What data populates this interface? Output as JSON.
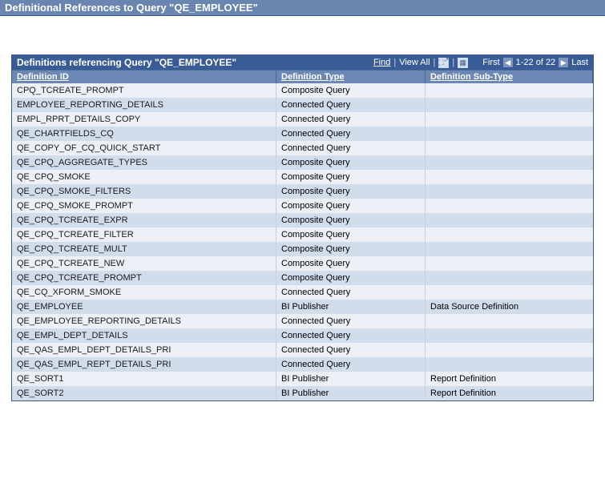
{
  "page_title": "Definitional References to Query \"QE_EMPLOYEE\"",
  "grid": {
    "title": "Definitions referencing Query \"QE_EMPLOYEE\"",
    "actions": {
      "find": "Find",
      "view_all": "View All"
    },
    "pager": {
      "first_label": "First",
      "range_label": "1-22 of 22",
      "last_label": "Last"
    },
    "columns": {
      "id": "Definition ID",
      "type": "Definition Type",
      "subtype": "Definition Sub-Type"
    },
    "rows": [
      {
        "id": "CPQ_TCREATE_PROMPT",
        "type": "Composite Query",
        "subtype": ""
      },
      {
        "id": "EMPLOYEE_REPORTING_DETAILS",
        "type": "Connected Query",
        "subtype": ""
      },
      {
        "id": "EMPL_RPRT_DETAILS_COPY",
        "type": "Connected Query",
        "subtype": ""
      },
      {
        "id": "QE_CHARTFIELDS_CQ",
        "type": "Connected Query",
        "subtype": ""
      },
      {
        "id": "QE_COPY_OF_CQ_QUICK_START",
        "type": "Connected Query",
        "subtype": ""
      },
      {
        "id": "QE_CPQ_AGGREGATE_TYPES",
        "type": "Composite Query",
        "subtype": ""
      },
      {
        "id": "QE_CPQ_SMOKE",
        "type": "Composite Query",
        "subtype": ""
      },
      {
        "id": "QE_CPQ_SMOKE_FILTERS",
        "type": "Composite Query",
        "subtype": ""
      },
      {
        "id": "QE_CPQ_SMOKE_PROMPT",
        "type": "Composite Query",
        "subtype": ""
      },
      {
        "id": "QE_CPQ_TCREATE_EXPR",
        "type": "Composite Query",
        "subtype": ""
      },
      {
        "id": "QE_CPQ_TCREATE_FILTER",
        "type": "Composite Query",
        "subtype": ""
      },
      {
        "id": "QE_CPQ_TCREATE_MULT",
        "type": "Composite Query",
        "subtype": ""
      },
      {
        "id": "QE_CPQ_TCREATE_NEW",
        "type": "Composite Query",
        "subtype": ""
      },
      {
        "id": "QE_CPQ_TCREATE_PROMPT",
        "type": "Composite Query",
        "subtype": ""
      },
      {
        "id": "QE_CQ_XFORM_SMOKE",
        "type": "Connected Query",
        "subtype": ""
      },
      {
        "id": "QE_EMPLOYEE",
        "type": "BI Publisher",
        "subtype": "Data Source Definition"
      },
      {
        "id": "QE_EMPLOYEE_REPORTING_DETAILS",
        "type": "Connected Query",
        "subtype": ""
      },
      {
        "id": "QE_EMPL_DEPT_DETAILS",
        "type": "Connected Query",
        "subtype": ""
      },
      {
        "id": "QE_QAS_EMPL_DEPT_DETAILS_PRI",
        "type": "Connected Query",
        "subtype": ""
      },
      {
        "id": "QE_QAS_EMPL_REPT_DETAILS_PRI",
        "type": "Connected Query",
        "subtype": ""
      },
      {
        "id": "QE_SORT1",
        "type": "BI Publisher",
        "subtype": "Report Definition"
      },
      {
        "id": "QE_SORT2",
        "type": "BI Publisher",
        "subtype": "Report Definition"
      }
    ]
  }
}
